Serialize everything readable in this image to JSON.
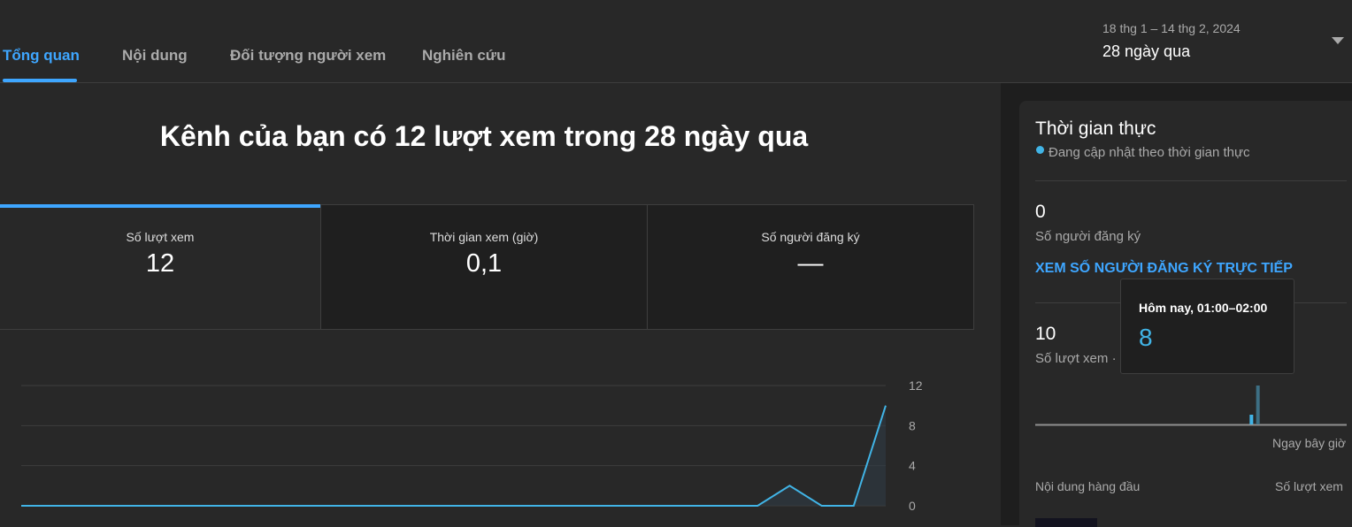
{
  "tabs": [
    {
      "label": "Tổng quan"
    },
    {
      "label": "Nội dung"
    },
    {
      "label": "Đối tượng người xem"
    },
    {
      "label": "Nghiên cứu"
    }
  ],
  "date_picker": {
    "range": "18 thg 1 – 14 thg 2, 2024",
    "label": "28 ngày qua"
  },
  "headline": "Kênh của bạn có 12 lượt xem trong 28 ngày qua",
  "metrics": [
    {
      "label": "Số lượt xem",
      "value": "12"
    },
    {
      "label": "Thời gian xem (giờ)",
      "value": "0,1"
    },
    {
      "label": "Số người đăng ký",
      "value": "—"
    }
  ],
  "chart_data": {
    "type": "line",
    "series": [
      {
        "values": [
          0,
          0,
          0,
          0,
          0,
          0,
          0,
          0,
          0,
          0,
          0,
          0,
          0,
          0,
          0,
          0,
          0,
          0,
          0,
          0,
          0,
          0,
          0,
          0,
          2,
          0,
          0,
          10
        ]
      }
    ],
    "y_ticks": [
      "12",
      "8",
      "4",
      "0"
    ],
    "ylim": [
      0,
      12
    ],
    "colors": {
      "line": "#41b4e6",
      "fill": "#2e3a44",
      "grid": "#3e3e3e"
    }
  },
  "realtime": {
    "title": "Thời gian thực",
    "subtitle": "Đang cập nhật theo thời gian thực",
    "subscribers_value": "0",
    "subscribers_label": "Số người đăng ký",
    "subscribers_link": "XEM SỐ NGƯỜI ĐĂNG KÝ TRỰC TIẾP",
    "views_value": "10",
    "views_label": "Số lượt xem ·",
    "now_label": "Ngay bây giờ",
    "top_content_label": "Nội dung hàng đầu",
    "top_content_views": "Số lượt xem",
    "hourly_views": [
      {
        "hour": "-14",
        "value": 2
      },
      {
        "hour": "-13",
        "value": 8
      }
    ]
  },
  "tooltip": {
    "label": "Hôm nay, 01:00–02:00",
    "value": "8"
  }
}
